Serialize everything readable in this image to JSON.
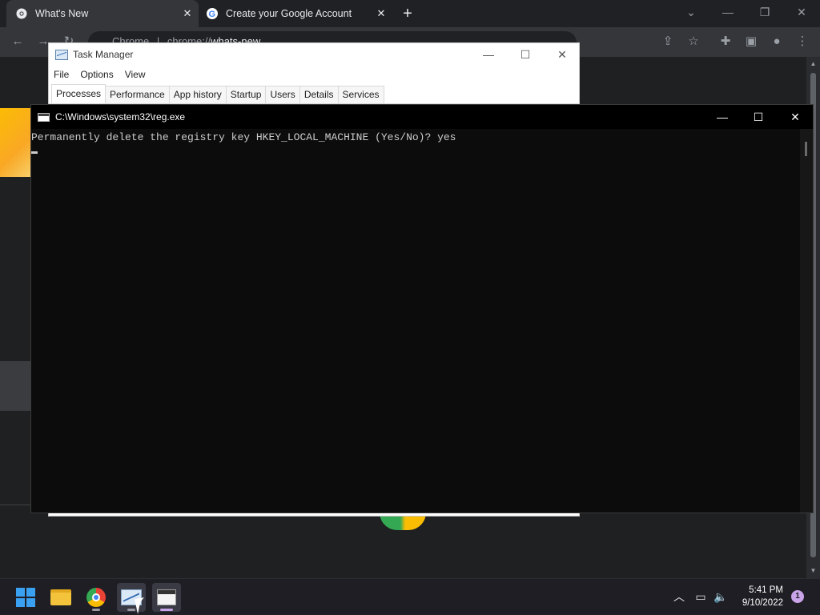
{
  "chrome": {
    "tabs": [
      {
        "title": "What's New",
        "active": true
      },
      {
        "title": "Create your Google Account",
        "active": false
      }
    ],
    "new_tab_symbol": "+",
    "omnibox": {
      "prefix": "Chrome",
      "separator": "|",
      "url_scheme": "chrome://",
      "url_path": "whats-new"
    },
    "accent": "#35363a"
  },
  "task_manager": {
    "title": "Task Manager",
    "menu": [
      "File",
      "Options",
      "View"
    ],
    "tabs": [
      "Processes",
      "Performance",
      "App history",
      "Startup",
      "Users",
      "Details",
      "Services"
    ],
    "active_tab": "Processes"
  },
  "console": {
    "title": "C:\\Windows\\system32\\reg.exe",
    "prompt_line": "Permanently delete the registry key HKEY_LOCAL_MACHINE (Yes/No)? yes",
    "background": "#0c0c0c",
    "text_color": "#cccccc"
  },
  "taskbar": {
    "apps": [
      "start",
      "file-explorer",
      "google-chrome",
      "task-manager",
      "command-prompt"
    ],
    "clock": {
      "time": "5:41 PM",
      "date": "9/10/2022"
    },
    "notification_count": "1"
  }
}
